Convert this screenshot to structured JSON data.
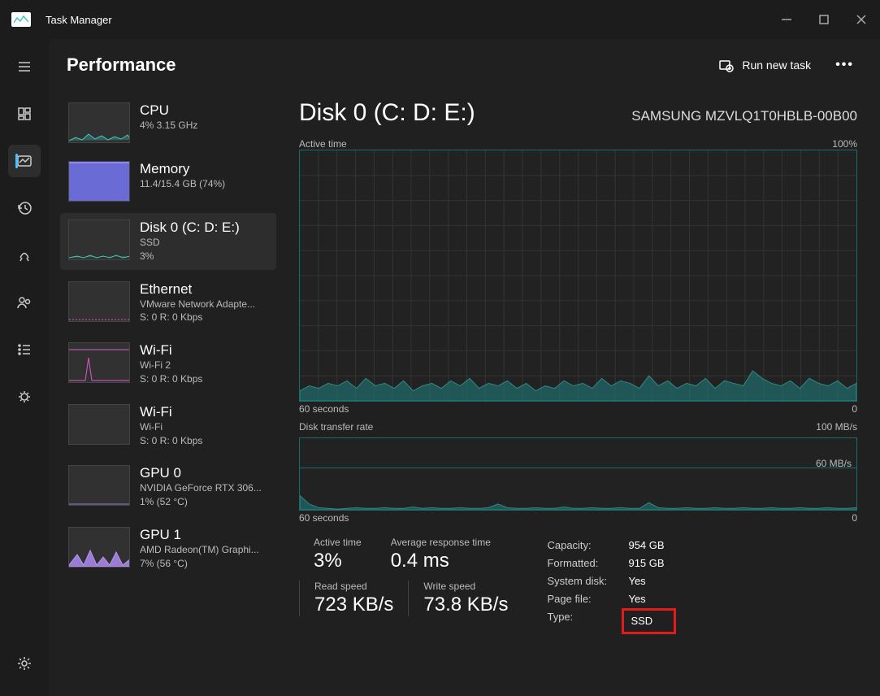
{
  "app": {
    "title": "Task Manager"
  },
  "header": {
    "page": "Performance",
    "run_task": "Run new task",
    "more": "…"
  },
  "sidebar": [
    {
      "title": "CPU",
      "line2": "4%  3.15 GHz",
      "line3": "",
      "thumb": "cpu"
    },
    {
      "title": "Memory",
      "line2": "11.4/15.4 GB (74%)",
      "line3": "",
      "thumb": "mem"
    },
    {
      "title": "Disk 0 (C: D: E:)",
      "line2": "SSD",
      "line3": "3%",
      "thumb": "disk",
      "selected": true
    },
    {
      "title": "Ethernet",
      "line2": "VMware Network Adapte...",
      "line3": "S: 0  R: 0 Kbps",
      "thumb": "eth"
    },
    {
      "title": "Wi-Fi",
      "line2": "Wi-Fi 2",
      "line3": "S: 0  R: 0 Kbps",
      "thumb": "wifi1"
    },
    {
      "title": "Wi-Fi",
      "line2": "Wi-Fi",
      "line3": "S: 0  R: 0 Kbps",
      "thumb": "wifi2"
    },
    {
      "title": "GPU 0",
      "line2": "NVIDIA GeForce RTX 306...",
      "line3": "1%  (52 °C)",
      "thumb": "gpu0"
    },
    {
      "title": "GPU 1",
      "line2": "AMD Radeon(TM) Graphi...",
      "line3": "7%  (56 °C)",
      "thumb": "gpu1"
    }
  ],
  "detail": {
    "title": "Disk 0 (C: D: E:)",
    "model": "SAMSUNG MZVLQ1T0HBLB-00B00",
    "chart1": {
      "label": "Active time",
      "max": "100%",
      "x_left": "60 seconds",
      "x_right": "0"
    },
    "chart2": {
      "label": "Disk transfer rate",
      "max": "100 MB/s",
      "mid": "60 MB/s",
      "x_left": "60 seconds",
      "x_right": "0"
    },
    "stats": {
      "active_time": {
        "label": "Active time",
        "value": "3%"
      },
      "avg_resp": {
        "label": "Average response time",
        "value": "0.4 ms"
      },
      "read": {
        "label": "Read speed",
        "value": "723 KB/s"
      },
      "write": {
        "label": "Write speed",
        "value": "73.8 KB/s"
      }
    },
    "props": {
      "capacity": {
        "k": "Capacity:",
        "v": "954 GB"
      },
      "formatted": {
        "k": "Formatted:",
        "v": "915 GB"
      },
      "system_disk": {
        "k": "System disk:",
        "v": "Yes"
      },
      "page_file": {
        "k": "Page file:",
        "v": "Yes"
      },
      "type": {
        "k": "Type:",
        "v": "SSD"
      }
    }
  },
  "chart_data": [
    {
      "type": "area",
      "title": "Active time",
      "ylabel": "%",
      "ylim": [
        0,
        100
      ],
      "x_seconds": [
        60,
        0
      ],
      "values": [
        4,
        6,
        5,
        7,
        6,
        8,
        5,
        9,
        6,
        7,
        5,
        8,
        4,
        6,
        7,
        5,
        8,
        6,
        9,
        5,
        7,
        6,
        8,
        5,
        7,
        4,
        6,
        5,
        8,
        6,
        7,
        5,
        9,
        6,
        8,
        7,
        5,
        10,
        6,
        8,
        5,
        7,
        6,
        9,
        5,
        8,
        7,
        6,
        12,
        9,
        7,
        6,
        8,
        5,
        9,
        7,
        6,
        8,
        5,
        7
      ]
    },
    {
      "type": "area",
      "title": "Disk transfer rate",
      "ylabel": "MB/s",
      "ylim": [
        0,
        100
      ],
      "x_seconds": [
        60,
        0
      ],
      "series": [
        {
          "name": "Read",
          "values": [
            20,
            8,
            3,
            2,
            1,
            2,
            3,
            2,
            2,
            3,
            2,
            2,
            4,
            2,
            3,
            2,
            2,
            3,
            2,
            2,
            3,
            8,
            3,
            2,
            2,
            3,
            2,
            2,
            4,
            2,
            2,
            3,
            2,
            2,
            3,
            2,
            2,
            10,
            3,
            2,
            2,
            3,
            2,
            2,
            3,
            2,
            2,
            3,
            2,
            2,
            3,
            2,
            2,
            3,
            2,
            2,
            3,
            2,
            2,
            3
          ]
        },
        {
          "name": "Write",
          "values": [
            2,
            1,
            1,
            1,
            1,
            1,
            1,
            1,
            1,
            1,
            1,
            1,
            1,
            1,
            1,
            1,
            1,
            1,
            1,
            1,
            1,
            1,
            1,
            1,
            1,
            1,
            1,
            1,
            1,
            1,
            1,
            1,
            1,
            1,
            1,
            1,
            1,
            1,
            1,
            1,
            1,
            1,
            1,
            1,
            1,
            1,
            1,
            1,
            1,
            1,
            1,
            1,
            1,
            1,
            1,
            1,
            1,
            1,
            1,
            1
          ]
        }
      ]
    }
  ]
}
